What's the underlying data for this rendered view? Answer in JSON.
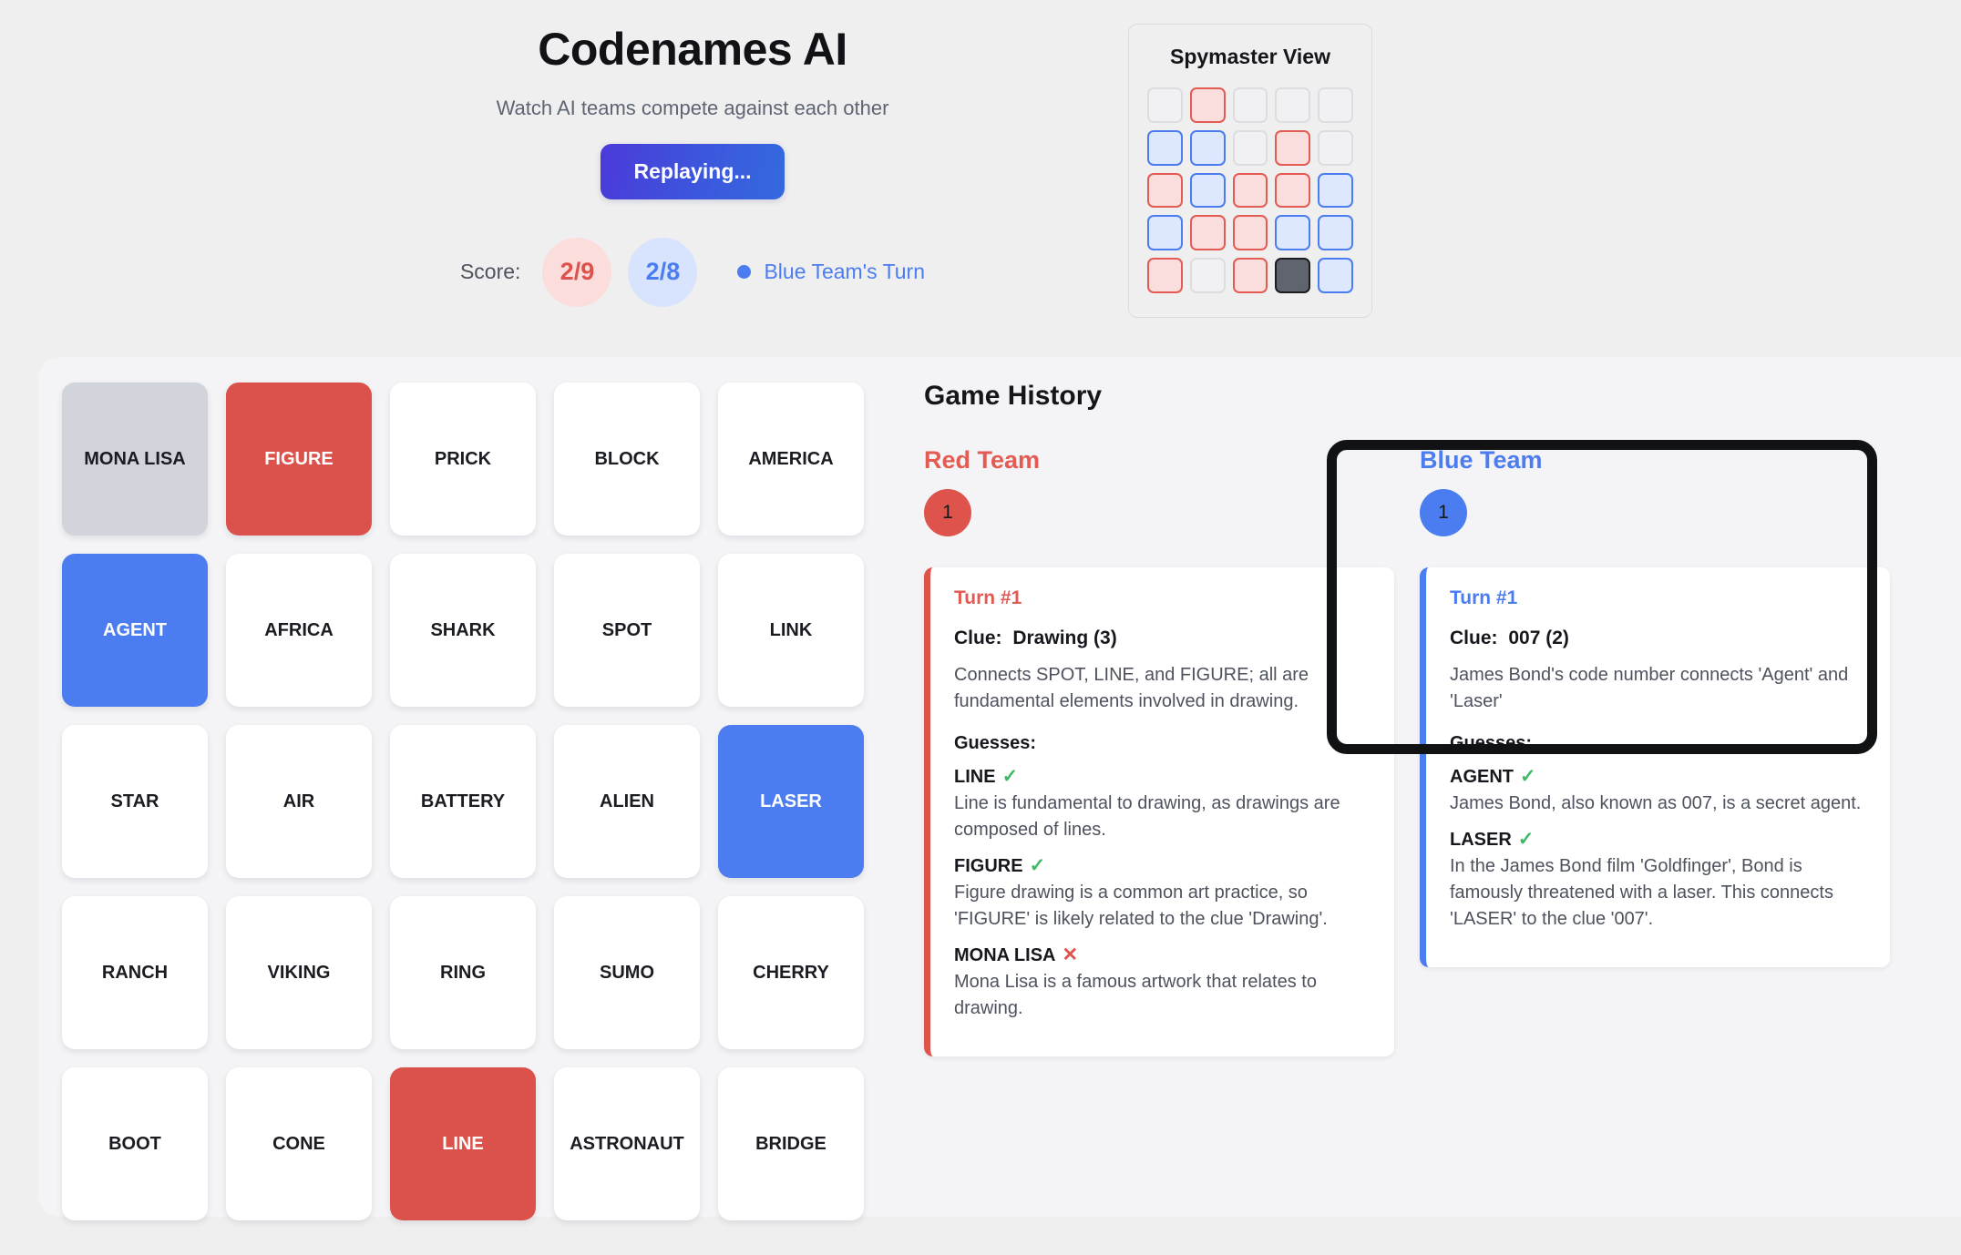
{
  "header": {
    "title": "Codenames AI",
    "subtitle": "Watch AI teams compete against each other",
    "replay_button": "Replaying...",
    "score_label": "Score:",
    "score_red": "2/9",
    "score_blue": "2/8",
    "turn_status": "Blue Team's Turn",
    "turn_dot_color": "#4b7cf0"
  },
  "spymaster": {
    "title": "Spymaster View",
    "cells": [
      "neutral",
      "red",
      "neutral",
      "neutral",
      "neutral",
      "blue",
      "blue",
      "neutral",
      "red",
      "neutral",
      "red",
      "blue",
      "red",
      "red",
      "blue",
      "blue",
      "red",
      "red",
      "blue",
      "blue",
      "red",
      "neutral",
      "red",
      "assassin",
      "blue"
    ],
    "colors": {
      "red": "#e35b53",
      "blue": "#4b7cf0",
      "neutral": "#dcdde1",
      "assassin": "#5f646f"
    }
  },
  "board": {
    "cards": [
      {
        "word": "MONA LISA",
        "state": "neutral"
      },
      {
        "word": "FIGURE",
        "state": "red"
      },
      {
        "word": "PRICK",
        "state": "hidden"
      },
      {
        "word": "BLOCK",
        "state": "hidden"
      },
      {
        "word": "AMERICA",
        "state": "hidden"
      },
      {
        "word": "AGENT",
        "state": "blue"
      },
      {
        "word": "AFRICA",
        "state": "hidden"
      },
      {
        "word": "SHARK",
        "state": "hidden"
      },
      {
        "word": "SPOT",
        "state": "hidden"
      },
      {
        "word": "LINK",
        "state": "hidden"
      },
      {
        "word": "STAR",
        "state": "hidden"
      },
      {
        "word": "AIR",
        "state": "hidden"
      },
      {
        "word": "BATTERY",
        "state": "hidden"
      },
      {
        "word": "ALIEN",
        "state": "hidden"
      },
      {
        "word": "LASER",
        "state": "blue"
      },
      {
        "word": "RANCH",
        "state": "hidden"
      },
      {
        "word": "VIKING",
        "state": "hidden"
      },
      {
        "word": "RING",
        "state": "hidden"
      },
      {
        "word": "SUMO",
        "state": "hidden"
      },
      {
        "word": "CHERRY",
        "state": "hidden"
      },
      {
        "word": "BOOT",
        "state": "hidden"
      },
      {
        "word": "CONE",
        "state": "hidden"
      },
      {
        "word": "LINE",
        "state": "red"
      },
      {
        "word": "ASTRONAUT",
        "state": "hidden"
      },
      {
        "word": "BRIDGE",
        "state": "hidden"
      }
    ]
  },
  "history": {
    "title": "Game History",
    "guesses_label": "Guesses:",
    "clue_label": "Clue:",
    "red_team": {
      "name": "Red Team",
      "badge": "1",
      "accent": "#df534d",
      "turn": {
        "heading": "Turn #1",
        "clue": "Drawing (3)",
        "reasoning": "Connects SPOT, LINE, and FIGURE; all are fundamental elements involved in drawing.",
        "guesses": [
          {
            "word": "LINE",
            "mark": "✓",
            "result": "correct",
            "reason": "Line is fundamental to drawing, as drawings are composed of lines."
          },
          {
            "word": "FIGURE",
            "mark": "✓",
            "result": "correct",
            "reason": "Figure drawing is a common art practice, so 'FIGURE' is likely related to the clue 'Drawing'."
          },
          {
            "word": "MONA LISA",
            "mark": "✕",
            "result": "wrong",
            "reason": "Mona Lisa is a famous artwork that relates to drawing."
          }
        ]
      }
    },
    "blue_team": {
      "name": "Blue Team",
      "badge": "1",
      "accent": "#4b7cf0",
      "turn": {
        "heading": "Turn #1",
        "clue": "007 (2)",
        "reasoning": "James Bond's code number connects 'Agent' and 'Laser'",
        "guesses": [
          {
            "word": "AGENT",
            "mark": "✓",
            "result": "correct",
            "reason": "James Bond, also known as 007, is a secret agent."
          },
          {
            "word": "LASER",
            "mark": "✓",
            "result": "correct",
            "reason": "In the James Bond film 'Goldfinger', Bond is famously threatened with a laser. This connects 'LASER' to the clue '007'."
          }
        ]
      }
    }
  }
}
